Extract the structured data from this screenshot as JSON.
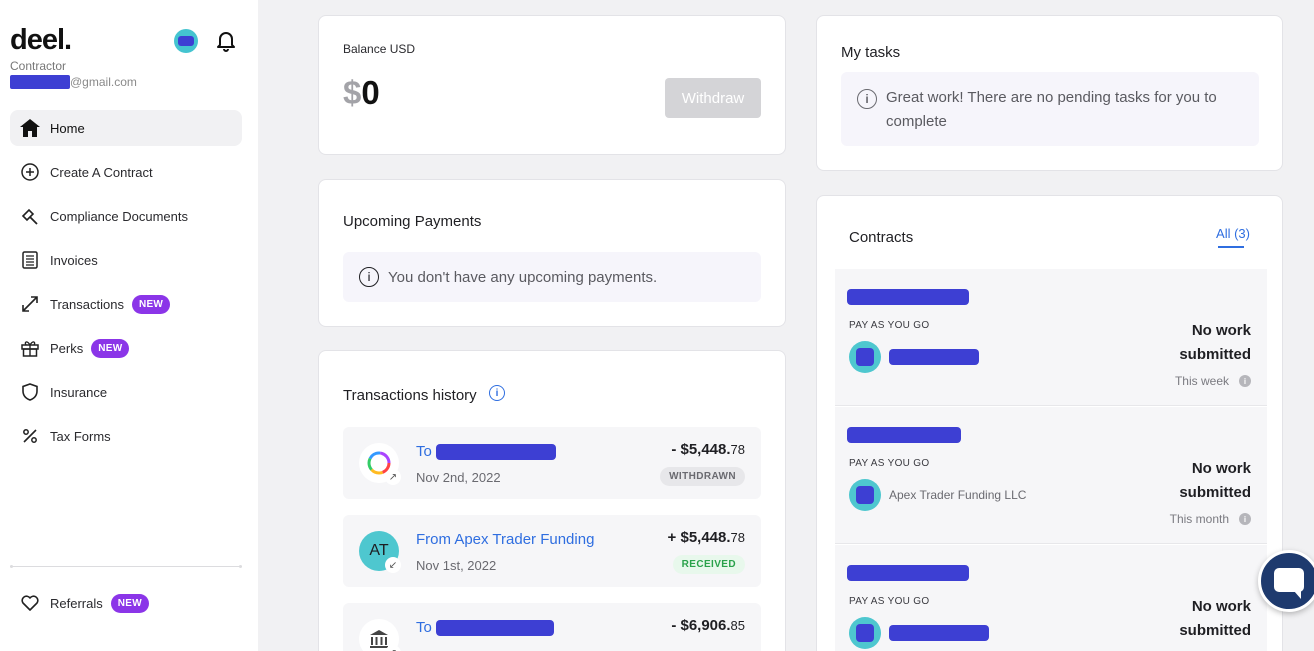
{
  "sidebar": {
    "logo": "deel.",
    "role": "Contractor",
    "email_suffix": "@gmail.com",
    "nav": [
      {
        "label": "Home",
        "icon": "home-icon",
        "badge": ""
      },
      {
        "label": "Create A Contract",
        "icon": "plus-circle-icon",
        "badge": ""
      },
      {
        "label": "Compliance Documents",
        "icon": "gavel-icon",
        "badge": ""
      },
      {
        "label": "Invoices",
        "icon": "invoice-icon",
        "badge": ""
      },
      {
        "label": "Transactions",
        "icon": "transfer-arrows-icon",
        "badge": "NEW"
      },
      {
        "label": "Perks",
        "icon": "gift-icon",
        "badge": "NEW"
      },
      {
        "label": "Insurance",
        "icon": "shield-icon",
        "badge": ""
      },
      {
        "label": "Tax Forms",
        "icon": "percent-icon",
        "badge": ""
      }
    ],
    "referrals": {
      "label": "Referrals",
      "icon": "heart-icon",
      "badge": "NEW"
    }
  },
  "balance": {
    "label": "Balance USD",
    "currency_symbol": "$",
    "amount": "0",
    "withdraw_label": "Withdraw"
  },
  "upcoming": {
    "title": "Upcoming Payments",
    "message": "You don't have any upcoming payments."
  },
  "transactions": {
    "title": "Transactions history",
    "rows": [
      {
        "name": "To",
        "date": "Nov 2nd, 2022",
        "sign": "- ",
        "amount": "$5,448.",
        "cents": "78",
        "status": "WITHDRAWN",
        "avatar": "",
        "icon": "ring-logo-icon"
      },
      {
        "name": "From Apex Trader Funding",
        "date": "Nov 1st, 2022",
        "sign": "+ ",
        "amount": "$5,448.",
        "cents": "78",
        "status": "RECEIVED",
        "avatar": "AT",
        "icon": "avatar-initials"
      },
      {
        "name": "To",
        "date": "",
        "sign": "- ",
        "amount": "$6,906.",
        "cents": "85",
        "status": "",
        "avatar": "",
        "icon": "bank-icon"
      }
    ]
  },
  "tasks": {
    "title": "My tasks",
    "message": "Great work! There are no pending tasks for you to complete"
  },
  "contracts": {
    "title": "Contracts",
    "all_label": "All (3)",
    "items": [
      {
        "type": "PAY AS YOU GO",
        "party": "",
        "status": "No work submitted",
        "period": "This week"
      },
      {
        "type": "PAY AS YOU GO",
        "party": "Apex Trader Funding LLC",
        "status": "No work submitted",
        "period": "This month"
      },
      {
        "type": "PAY AS YOU GO",
        "party": "",
        "status": "No work submitted",
        "period": ""
      }
    ]
  },
  "colors": {
    "accent": "#2f6ee0",
    "badge": "#8b35e8",
    "redaction": "#3d3fd3",
    "teal": "#4ec7cf"
  }
}
